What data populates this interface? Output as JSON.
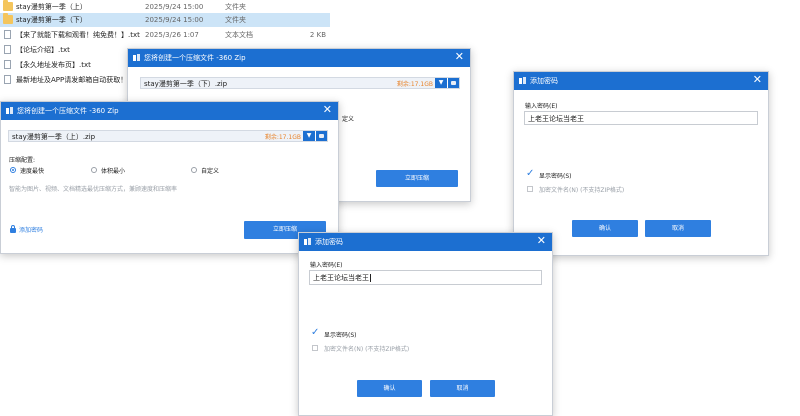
{
  "files": [
    {
      "name": "stay漫剪第一季（上）",
      "date": "2025/9/24 15:00",
      "type": "文件夹",
      "size": "",
      "icon": "folder-icon",
      "selected": false
    },
    {
      "name": "stay漫剪第一季（下）",
      "date": "2025/9/24 15:00",
      "type": "文件夹",
      "size": "",
      "icon": "folder-icon",
      "selected": true
    },
    {
      "name": "【来了就能下载和观看！纯免费！】.txt",
      "date": "2025/3/26 1:07",
      "type": "文本文档",
      "size": "2 KB",
      "icon": "text-file-icon",
      "selected": false
    },
    {
      "name": "【论坛介绍】.txt",
      "date": "",
      "type": "",
      "size": "",
      "icon": "text-file-icon",
      "selected": false
    },
    {
      "name": "【永久地址发布页】.txt",
      "date": "",
      "type": "",
      "size": "",
      "icon": "text-file-icon",
      "selected": false
    },
    {
      "name": "最新地址及APP请发邮箱自动获取！！！",
      "date": "",
      "type": "",
      "size": "",
      "icon": "text-file-icon",
      "selected": false
    }
  ],
  "zip_dialog_back": {
    "title": "您将创建一个压缩文件 -360 Zip",
    "path": "stay漫剪第一季（下）.zip",
    "size": "剩余:17.1GB",
    "partial_label": "定义",
    "compress_button": "立即压缩"
  },
  "zip_dialog_front": {
    "title": "您将创建一个压缩文件 -360 Zip",
    "path": "stay漫剪第一季（上）.zip",
    "size": "剩余:17.1GB",
    "config_label": "压缩配置:",
    "options": [
      "速度最快",
      "体积最小",
      "自定义"
    ],
    "hint": "智能为图片、视频、文档精选最优压缩方式，兼顾速度和压缩率",
    "add_password": "添加密码",
    "compress_button": "立即压缩"
  },
  "pwd_dialog_right": {
    "title": "添加密码",
    "input_label": "输入密码(E)",
    "password": "上老王论坛当老王",
    "show_password": "显示密码(S)",
    "encrypt_names": "加密文件名(N) (不支持ZIP格式)",
    "ok": "确认",
    "cancel": "取消"
  },
  "pwd_dialog_front": {
    "title": "添加密码",
    "input_label": "输入密码(E)",
    "password": "上老王论坛当老王",
    "show_password": "显示密码(S)",
    "encrypt_names": "加密文件名(N) (不支持ZIP格式)",
    "ok": "确认",
    "cancel": "取消"
  },
  "colors": {
    "accent": "#1c6fd1",
    "button": "#2f7fe0",
    "selection": "#cce4f7",
    "size_text": "#e8832a"
  }
}
